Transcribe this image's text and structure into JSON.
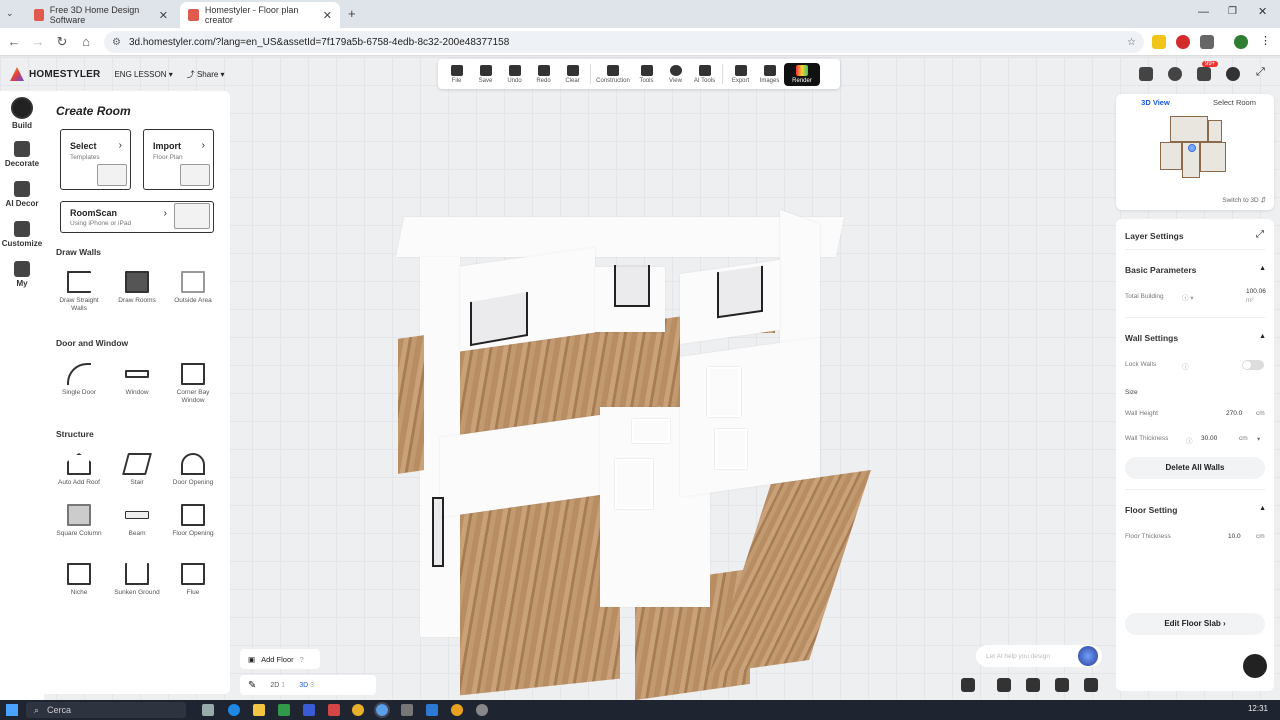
{
  "browser": {
    "tabs": [
      {
        "title": "Free 3D Home Design Software",
        "active": false
      },
      {
        "title": "Homestyler - Floor plan creator",
        "active": true
      }
    ],
    "new_tab": "+",
    "url": "3d.homestyler.com/?lang=en_US&assetId=7f179a5b-6758-4edb-8c32-200e48377158"
  },
  "app": {
    "brand": "HOMESTYLER",
    "project_name": "ENG LESSON",
    "share_label": "Share",
    "toolbar": [
      {
        "label": "File",
        "icon": "folder-icon"
      },
      {
        "label": "Save",
        "icon": "save-icon"
      },
      {
        "label": "Undo",
        "icon": "undo-icon"
      },
      {
        "label": "Redo",
        "icon": "redo-icon"
      },
      {
        "label": "Clear",
        "icon": "eraser-icon"
      },
      {
        "label": "Construction",
        "icon": "construction-icon"
      },
      {
        "label": "Tools",
        "icon": "tools-icon"
      },
      {
        "label": "View",
        "icon": "eye-icon"
      },
      {
        "label": "AI Tools",
        "icon": "ai-icon"
      },
      {
        "label": "Export",
        "icon": "export-icon"
      },
      {
        "label": "Images",
        "icon": "images-icon"
      },
      {
        "label": "Render",
        "icon": "render-icon"
      }
    ],
    "notification_badge": "99+"
  },
  "rail": [
    {
      "label": "Build",
      "icon": "build-icon",
      "active": true
    },
    {
      "label": "Decorate",
      "icon": "decorate-icon"
    },
    {
      "label": "AI Decor",
      "icon": "ai-decor-icon"
    },
    {
      "label": "Customize",
      "icon": "customize-icon"
    },
    {
      "label": "My",
      "icon": "my-icon"
    }
  ],
  "panel": {
    "title": "Create Room",
    "cards": [
      {
        "title": "Select",
        "subtitle": "Templates"
      },
      {
        "title": "Import",
        "subtitle": "Floor Plan"
      },
      {
        "title": "RoomScan",
        "subtitle": "Using iPhone or iPad"
      }
    ],
    "sections": {
      "draw_walls": "Draw Walls",
      "door_window": "Door and Window",
      "structure": "Structure"
    },
    "draw_walls": [
      "Draw Straight Walls",
      "Draw Rooms",
      "Outside Area"
    ],
    "door_window": [
      "Single Door",
      "Window",
      "Corner Bay Window"
    ],
    "structure": [
      "Auto Add Roof",
      "Stair",
      "Door Opening",
      "Square Column",
      "Beam",
      "Floor Opening",
      "Niche",
      "Sunken Ground",
      "Flue"
    ]
  },
  "minimap": {
    "tab_3d": "3D View",
    "tab_select": "Select Room",
    "switch": "Switch to 3D"
  },
  "props": {
    "layer_settings": "Layer Settings",
    "basic_parameters": "Basic Parameters",
    "total_building_label": "Total Building",
    "total_building_value": "100.06",
    "total_building_unit": "m²",
    "wall_settings": "Wall Settings",
    "lock_walls": "Lock Walls",
    "size": "Size",
    "wall_height_label": "Wall Height",
    "wall_height_value": "270.0",
    "wall_height_unit": "cm",
    "wall_thickness_label": "Wall Thickness",
    "wall_thickness_value": "30.00",
    "wall_thickness_unit": "cm",
    "delete_walls": "Delete All Walls",
    "floor_setting": "Floor Setting",
    "floor_thickness_label": "Floor Thickness",
    "floor_thickness_value": "10.0",
    "floor_thickness_unit": "cm",
    "edit_floor_slab": "Edit Floor Slab"
  },
  "bottom": {
    "add_floor": "Add Floor",
    "view_2d": "2D",
    "view_2d_key": "1",
    "view_3d": "3D",
    "view_3d_key": "3",
    "ai_placeholder": "Let AI help you design"
  },
  "taskbar": {
    "search": "Cerca",
    "clock": "12:31"
  },
  "colors": {
    "accent": "#1a56d6",
    "floor_wood": "#c29a70"
  }
}
